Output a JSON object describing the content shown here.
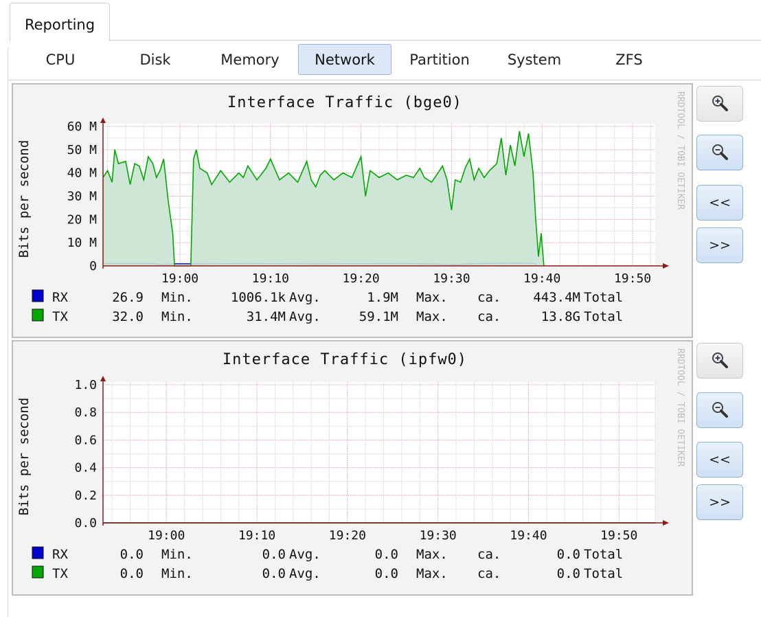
{
  "tabs": {
    "main": "Reporting"
  },
  "subtabs": [
    "CPU",
    "Disk",
    "Memory",
    "Network",
    "Partition",
    "System",
    "ZFS"
  ],
  "active_subtab": "Network",
  "side_buttons": {
    "zoom_in_icon": "zoom-in",
    "zoom_out_icon": "zoom-out",
    "back": "<<",
    "forward": ">>"
  },
  "colors": {
    "rx": "#0000cc",
    "tx": "#00a800",
    "tx_fill": "#c8e3d0",
    "grid": "#f0a0a0",
    "axis": "#8b1a1a"
  },
  "chart_data": [
    {
      "type": "area",
      "title": "Interface Traffic (bge0)",
      "ylabel": "Bits per second",
      "watermark": "RRDTOOL / TOBI OETIKER",
      "x_ticks": [
        "19:00",
        "19:10",
        "19:20",
        "19:30",
        "19:40",
        "19:50"
      ],
      "y_ticks": [
        "0",
        "10 M",
        "20 M",
        "30 M",
        "40 M",
        "50 M",
        "60 M"
      ],
      "ylim": [
        0,
        60
      ],
      "x_start_min": -8.5,
      "x_end_min": 52.5,
      "series": [
        {
          "name": "RX",
          "unit": "M",
          "points": [
            [
              -8.5,
              1.0
            ],
            [
              -3.0,
              1.0
            ],
            [
              -2.0,
              0.6
            ],
            [
              -0.6,
              0.9
            ],
            [
              1.5,
              0.9
            ],
            [
              2.5,
              0.9
            ],
            [
              7.0,
              1.0
            ],
            [
              15.0,
              0.9
            ],
            [
              25.0,
              1.0
            ],
            [
              30.5,
              0.6
            ],
            [
              33.0,
              1.0
            ],
            [
              37.0,
              1.2
            ],
            [
              39.0,
              1.1
            ],
            [
              39.4,
              0.5
            ]
          ]
        },
        {
          "name": "TX",
          "unit": "M",
          "points": [
            [
              -8.5,
              38
            ],
            [
              -8.0,
              41
            ],
            [
              -7.5,
              36
            ],
            [
              -7.2,
              50
            ],
            [
              -6.8,
              44
            ],
            [
              -6.0,
              45
            ],
            [
              -5.5,
              35
            ],
            [
              -5.0,
              44
            ],
            [
              -4.5,
              43
            ],
            [
              -4.0,
              37
            ],
            [
              -3.5,
              47
            ],
            [
              -3.0,
              44
            ],
            [
              -2.6,
              38
            ],
            [
              -2.2,
              41
            ],
            [
              -1.8,
              46
            ],
            [
              -1.3,
              28
            ],
            [
              -0.8,
              14
            ],
            [
              -0.6,
              0
            ],
            [
              1.2,
              0
            ],
            [
              1.5,
              46
            ],
            [
              1.8,
              50
            ],
            [
              2.2,
              42
            ],
            [
              3.0,
              40
            ],
            [
              3.5,
              35
            ],
            [
              4.0,
              38
            ],
            [
              4.5,
              41
            ],
            [
              5.5,
              36
            ],
            [
              6.5,
              40
            ],
            [
              7.0,
              38
            ],
            [
              7.5,
              43
            ],
            [
              8.5,
              37
            ],
            [
              9.5,
              42
            ],
            [
              10.0,
              46
            ],
            [
              11.0,
              37
            ],
            [
              12.0,
              40
            ],
            [
              13.0,
              36
            ],
            [
              14.0,
              45
            ],
            [
              14.5,
              37
            ],
            [
              15.0,
              34
            ],
            [
              15.5,
              39
            ],
            [
              16.0,
              41
            ],
            [
              17.0,
              37
            ],
            [
              18.0,
              40
            ],
            [
              19.0,
              38
            ],
            [
              20.0,
              47
            ],
            [
              20.5,
              30
            ],
            [
              21.0,
              41
            ],
            [
              22.0,
              38
            ],
            [
              23.0,
              40
            ],
            [
              24.0,
              37
            ],
            [
              25.0,
              39
            ],
            [
              25.8,
              38
            ],
            [
              26.5,
              42
            ],
            [
              27.0,
              38
            ],
            [
              27.8,
              36
            ],
            [
              28.5,
              40
            ],
            [
              29.0,
              43
            ],
            [
              29.5,
              37
            ],
            [
              30.0,
              24
            ],
            [
              30.4,
              37
            ],
            [
              31.0,
              36
            ],
            [
              31.5,
              42
            ],
            [
              32.0,
              46
            ],
            [
              32.5,
              37
            ],
            [
              33.0,
              42
            ],
            [
              33.6,
              38
            ],
            [
              34.2,
              41
            ],
            [
              35.0,
              44
            ],
            [
              35.5,
              55
            ],
            [
              36.0,
              39
            ],
            [
              36.5,
              52
            ],
            [
              37.0,
              43
            ],
            [
              37.5,
              58
            ],
            [
              38.0,
              47
            ],
            [
              38.5,
              57
            ],
            [
              39.0,
              40
            ],
            [
              39.3,
              20
            ],
            [
              39.6,
              4
            ],
            [
              39.9,
              14
            ],
            [
              40.2,
              0
            ]
          ]
        }
      ],
      "legend": [
        {
          "swatch": "rx",
          "label": "RX",
          "min": "26.9",
          "min_label": "Min.",
          "avg": "1006.1k",
          "avg_label": "Avg.",
          "max": "1.9M",
          "max_label": "Max.",
          "ca": "ca.",
          "total": "443.4M",
          "total_label": "Total"
        },
        {
          "swatch": "tx",
          "label": "TX",
          "min": "32.0",
          "min_label": "Min.",
          "avg": "31.4M",
          "avg_label": "Avg.",
          "max": "59.1M",
          "max_label": "Max.",
          "ca": "ca.",
          "total": "13.8G",
          "total_label": "Total"
        }
      ]
    },
    {
      "type": "line",
      "title": "Interface Traffic (ipfw0)",
      "ylabel": "Bits per second",
      "watermark": "RRDTOOL / TOBI OETIKER",
      "x_ticks": [
        "19:00",
        "19:10",
        "19:20",
        "19:30",
        "19:40",
        "19:50"
      ],
      "y_ticks": [
        "0.0",
        "0.2",
        "0.4",
        "0.6",
        "0.8",
        "1.0"
      ],
      "ylim": [
        0,
        1
      ],
      "x_start_min": -7.0,
      "x_end_min": 54.0,
      "series": [
        {
          "name": "RX",
          "points": [
            [
              -7.0,
              0
            ],
            [
              54.0,
              0
            ]
          ]
        },
        {
          "name": "TX",
          "points": [
            [
              -7.0,
              0
            ],
            [
              54.0,
              0
            ]
          ]
        }
      ],
      "legend": [
        {
          "swatch": "rx",
          "label": "RX",
          "min": "0.0",
          "min_label": "Min.",
          "avg": "0.0",
          "avg_label": "Avg.",
          "max": "0.0",
          "max_label": "Max.",
          "ca": "ca.",
          "total": "0.0",
          "total_label": "Total"
        },
        {
          "swatch": "tx",
          "label": "TX",
          "min": "0.0",
          "min_label": "Min.",
          "avg": "0.0",
          "avg_label": "Avg.",
          "max": "0.0",
          "max_label": "Max.",
          "ca": "ca.",
          "total": "0.0",
          "total_label": "Total"
        }
      ]
    }
  ]
}
